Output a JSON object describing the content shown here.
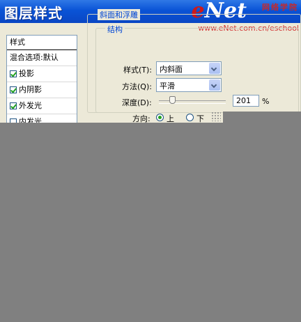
{
  "window": {
    "title": "图层样式"
  },
  "watermark": {
    "logo_e": "e",
    "logo_net": "Net",
    "cn": "网络学院",
    "url": "www.eNet.com.cn/eschool"
  },
  "style_list": {
    "header": "样式",
    "items": [
      {
        "label": "混合选项:默认",
        "checkbox": false,
        "checked": false
      },
      {
        "label": "投影",
        "checkbox": true,
        "checked": true
      },
      {
        "label": "内阴影",
        "checkbox": true,
        "checked": true
      },
      {
        "label": "外发光",
        "checkbox": true,
        "checked": true
      },
      {
        "label": "内发光",
        "checkbox": true,
        "checked": false
      }
    ]
  },
  "bevel": {
    "group_title": "斜面和浮雕",
    "structure_title": "结构",
    "style_label": "样式(T):",
    "style_value": "内斜面",
    "technique_label": "方法(Q):",
    "technique_value": "平滑",
    "depth_label": "深度(D):",
    "depth_value": "201",
    "depth_unit": "%",
    "direction_label": "方向:",
    "direction_up": "上",
    "direction_down": "下",
    "direction_selected": "up"
  },
  "colors": {
    "titlebar": "#0a53d6",
    "dialog_bg": "#ece9d8",
    "legend": "#0046d5",
    "overlay": "#808080"
  }
}
